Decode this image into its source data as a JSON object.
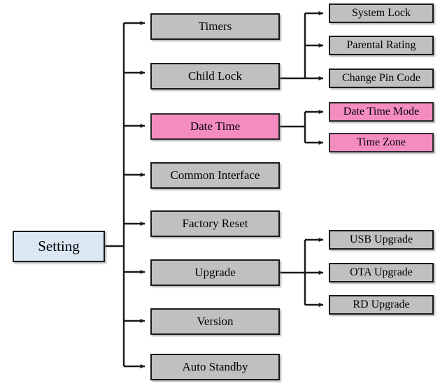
{
  "diagram": {
    "title": "Setting",
    "type": "tree",
    "colors": {
      "root_fill": "#dbe8f4",
      "branch_fill": "#c0c0c0",
      "highlight_fill": "#f58cc0",
      "border": "#1a1a1a",
      "connector": "#1a1a1a",
      "background": "#ffffff"
    },
    "root": {
      "label": "Setting",
      "style": "root"
    },
    "level1": [
      {
        "label": "Timers",
        "style": "gray"
      },
      {
        "label": "Child Lock",
        "style": "gray"
      },
      {
        "label": "Date Time",
        "style": "pink"
      },
      {
        "label": "Common Interface",
        "style": "gray"
      },
      {
        "label": "Factory Reset",
        "style": "gray"
      },
      {
        "label": "Upgrade",
        "style": "gray"
      },
      {
        "label": "Version",
        "style": "gray"
      },
      {
        "label": "Auto Standby",
        "style": "gray"
      }
    ],
    "level2": {
      "child_lock": [
        {
          "label": "System Lock",
          "style": "gray"
        },
        {
          "label": "Parental Rating",
          "style": "gray"
        },
        {
          "label": "Change Pin Code",
          "style": "gray"
        }
      ],
      "date_time": [
        {
          "label": "Date Time Mode",
          "style": "pink"
        },
        {
          "label": "Time Zone",
          "style": "pink"
        }
      ],
      "upgrade": [
        {
          "label": "USB Upgrade",
          "style": "gray"
        },
        {
          "label": "OTA Upgrade",
          "style": "gray"
        },
        {
          "label": "RD Upgrade",
          "style": "gray"
        }
      ]
    }
  }
}
